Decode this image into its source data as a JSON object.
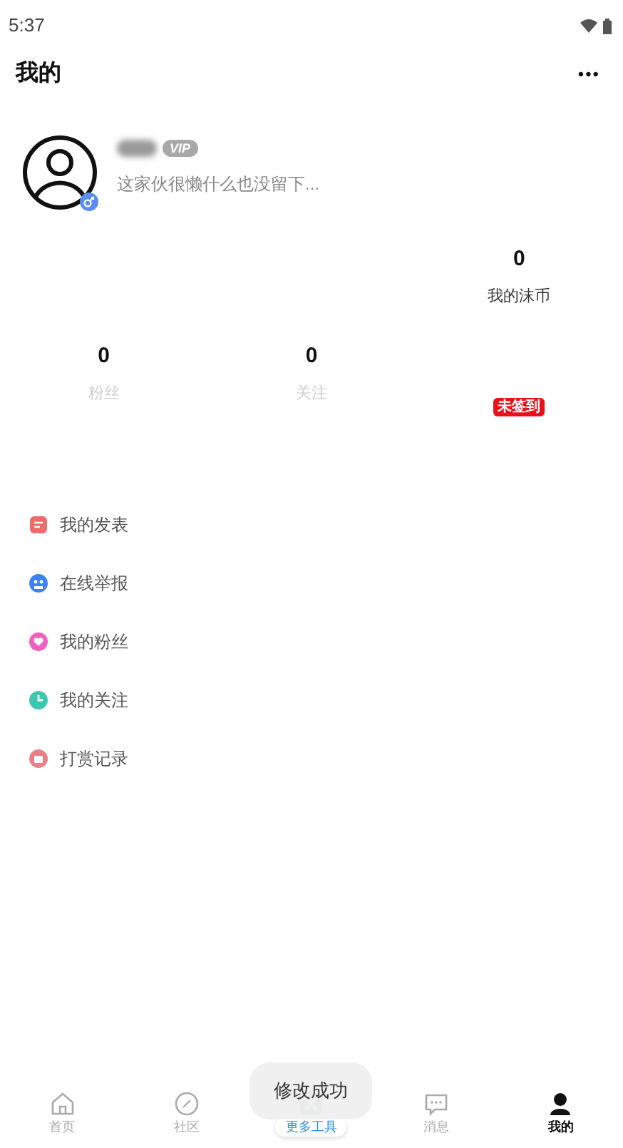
{
  "status_bar": {
    "time": "5:37"
  },
  "header": {
    "title": "我的",
    "more": "•••"
  },
  "profile": {
    "badge": "VIP",
    "bio": "这家伙很懒什么也没留下..."
  },
  "coins": {
    "value": "0",
    "label": "我的沫币"
  },
  "stats": [
    {
      "value": "0",
      "label": "粉丝"
    },
    {
      "value": "0",
      "label": "关注"
    }
  ],
  "sign_in": {
    "label": "未签到",
    "signed": false
  },
  "menu": [
    {
      "kind": "post",
      "label": "我的发表"
    },
    {
      "kind": "report",
      "label": "在线举报"
    },
    {
      "kind": "fans",
      "label": "我的粉丝"
    },
    {
      "kind": "follow",
      "label": "我的关注"
    },
    {
      "kind": "reward",
      "label": "打赏记录"
    }
  ],
  "tabs": [
    {
      "kind": "home",
      "label": "首页",
      "selected": false
    },
    {
      "kind": "community",
      "label": "社区",
      "selected": false
    },
    {
      "kind": "tools",
      "label": "更多工具",
      "selected": false
    },
    {
      "kind": "messages",
      "label": "消息",
      "selected": false
    },
    {
      "kind": "me",
      "label": "我的",
      "selected": true
    }
  ],
  "toast": "修改成功"
}
